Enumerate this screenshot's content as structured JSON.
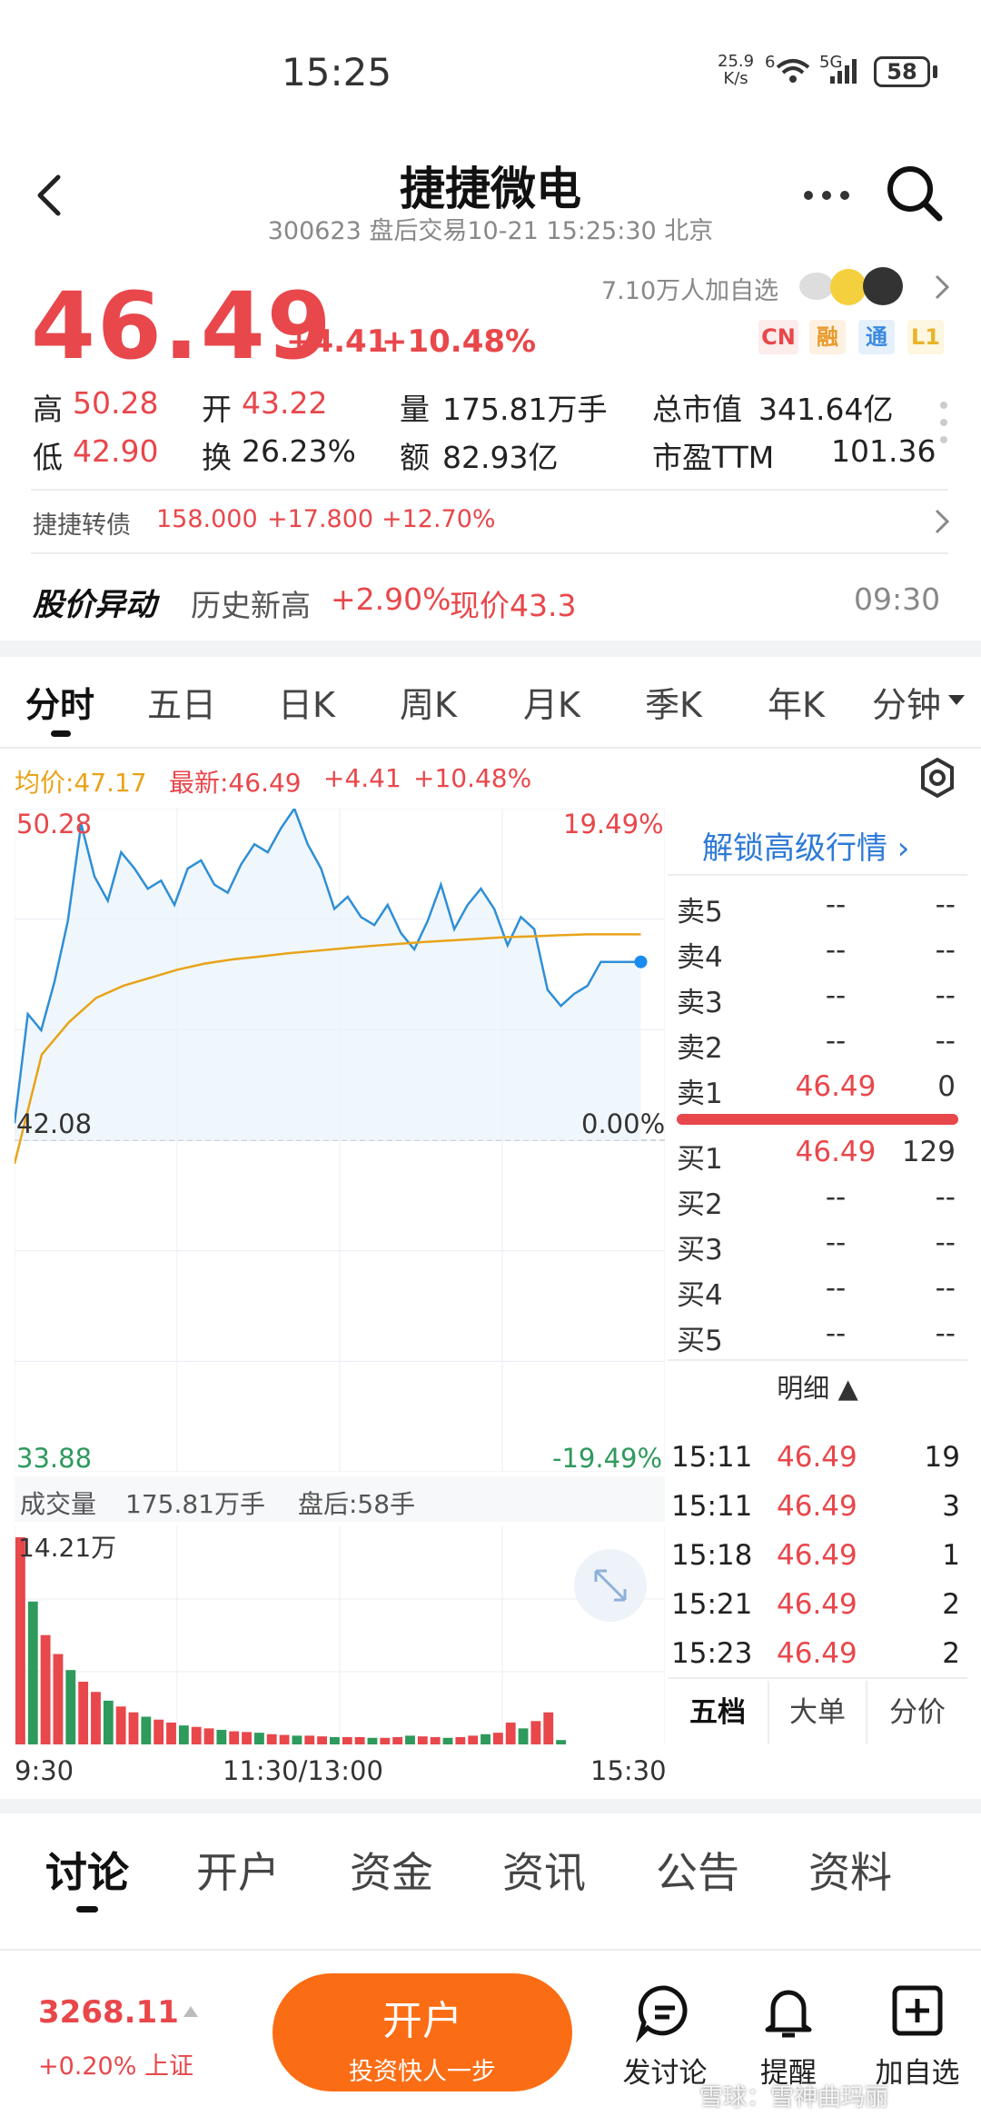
{
  "status": {
    "time": "15:25",
    "net_speed_top": "25.9",
    "net_speed_unit": "K/s",
    "signal_label": "6",
    "fiveg": "5G",
    "battery": "58"
  },
  "header": {
    "title": "捷捷微电",
    "subtitle": "300623 盘后交易10-21 15:25:30 北京"
  },
  "quote": {
    "price": "46.49",
    "change": "+4.41",
    "change_pct": "+10.48%",
    "followers": "7.10万人加自选",
    "badges": [
      "CN",
      "融",
      "通",
      "L1"
    ],
    "high_label": "高",
    "high": "50.28",
    "open_label": "开",
    "open": "43.22",
    "volume_label": "量",
    "volume": "175.81万手",
    "mcap_label": "总市值",
    "mcap": "341.64亿",
    "low_label": "低",
    "low": "42.90",
    "turnover_label": "换",
    "turnover": "26.23%",
    "amount_label": "额",
    "amount": "82.93亿",
    "pe_label": "市盈TTM",
    "pe": "101.36"
  },
  "bond": {
    "name": "捷捷转债",
    "price": "158.000",
    "change": "+17.800",
    "pct": "+12.70%"
  },
  "alert": {
    "title": "股价异动",
    "desc": "历史新高",
    "pct": "+2.90%",
    "price_text": "现价43.3",
    "time": "09:30"
  },
  "chart_tabs": [
    "分时",
    "五日",
    "日K",
    "周K",
    "月K",
    "季K",
    "年K",
    "分钟"
  ],
  "chart_header": {
    "avg": "均价:47.17",
    "latest": "最新:46.49",
    "change": "+4.41",
    "pct": "+10.48%"
  },
  "axis": {
    "top_left": "50.28",
    "top_right": "19.49%",
    "mid_left": "42.08",
    "mid_right": "0.00%",
    "bot_left": "33.88",
    "bot_right": "-19.49%",
    "time_start": "9:30",
    "time_mid": "11:30/13:00",
    "time_end": "15:30"
  },
  "volume_panel": {
    "label": "成交量",
    "total": "175.81万手",
    "after": "盘后:58手",
    "max": "14.21万"
  },
  "orderbook": {
    "unlock": "解锁高级行情 ›",
    "asks": [
      {
        "label": "卖5",
        "price": "--",
        "vol": "--"
      },
      {
        "label": "卖4",
        "price": "--",
        "vol": "--"
      },
      {
        "label": "卖3",
        "price": "--",
        "vol": "--"
      },
      {
        "label": "卖2",
        "price": "--",
        "vol": "--"
      },
      {
        "label": "卖1",
        "price": "46.49",
        "vol": "0"
      }
    ],
    "bids": [
      {
        "label": "买1",
        "price": "46.49",
        "vol": "129"
      },
      {
        "label": "买2",
        "price": "--",
        "vol": "--"
      },
      {
        "label": "买3",
        "price": "--",
        "vol": "--"
      },
      {
        "label": "买4",
        "price": "--",
        "vol": "--"
      },
      {
        "label": "买5",
        "price": "--",
        "vol": "--"
      }
    ],
    "detail_label": "明细 ▲",
    "ticks": [
      {
        "t": "15:11",
        "p": "46.49",
        "v": "19"
      },
      {
        "t": "15:11",
        "p": "46.49",
        "v": "3"
      },
      {
        "t": "15:18",
        "p": "46.49",
        "v": "1"
      },
      {
        "t": "15:21",
        "p": "46.49",
        "v": "2"
      },
      {
        "t": "15:23",
        "p": "46.49",
        "v": "2"
      }
    ],
    "tabs": [
      "五档",
      "大单",
      "分价"
    ]
  },
  "content_tabs": [
    "讨论",
    "开户",
    "资金",
    "资讯",
    "公告",
    "资料"
  ],
  "bottom": {
    "index_value": "3268.11",
    "index_change": "+0.20% 上证",
    "open_account": "开户",
    "open_sub": "投资快人一步",
    "discuss": "发讨论",
    "remind": "提醒",
    "add": "加自选",
    "watermark": "雪球：雪神曲玛丽"
  },
  "chart_data": {
    "type": "line",
    "x_range": [
      "9:30",
      "15:30"
    ],
    "ylim": [
      33.88,
      50.28
    ],
    "series": [
      {
        "name": "最新",
        "values": [
          42.5,
          45.2,
          44.8,
          46.0,
          47.5,
          49.9,
          48.6,
          48.0,
          49.2,
          48.8,
          48.3,
          48.5,
          47.9,
          48.8,
          49.0,
          48.4,
          48.2,
          48.9,
          49.4,
          49.2,
          49.8,
          50.28,
          49.4,
          48.8,
          47.8,
          48.1,
          47.6,
          47.4,
          47.9,
          47.2,
          46.8,
          47.5,
          48.4,
          47.3,
          47.9,
          48.3,
          47.8,
          46.9,
          47.6,
          47.3,
          45.8,
          45.4,
          45.7,
          45.9,
          46.49,
          46.49,
          46.49,
          46.49
        ]
      },
      {
        "name": "均价",
        "values": [
          41.5,
          44.2,
          45.0,
          45.6,
          45.9,
          46.1,
          46.3,
          46.45,
          46.55,
          46.62,
          46.7,
          46.76,
          46.82,
          46.88,
          46.93,
          46.98,
          47.02,
          47.06,
          47.1,
          47.12,
          47.15,
          47.17,
          47.17,
          47.17
        ]
      }
    ],
    "volume": [
      14.21,
      9.8,
      7.5,
      6.2,
      5.1,
      4.3,
      3.6,
      3.0,
      2.6,
      2.2,
      1.9,
      1.7,
      1.5,
      1.3,
      1.2,
      1.1,
      1.0,
      0.9,
      0.85,
      0.8,
      0.7,
      0.65,
      0.6,
      0.6,
      0.55,
      0.5,
      0.5,
      0.5,
      0.45,
      0.45,
      0.5,
      0.6,
      0.55,
      0.5,
      0.45,
      0.5,
      0.6,
      0.7,
      0.8,
      1.5,
      1.1,
      1.6,
      2.2,
      0.3
    ]
  }
}
